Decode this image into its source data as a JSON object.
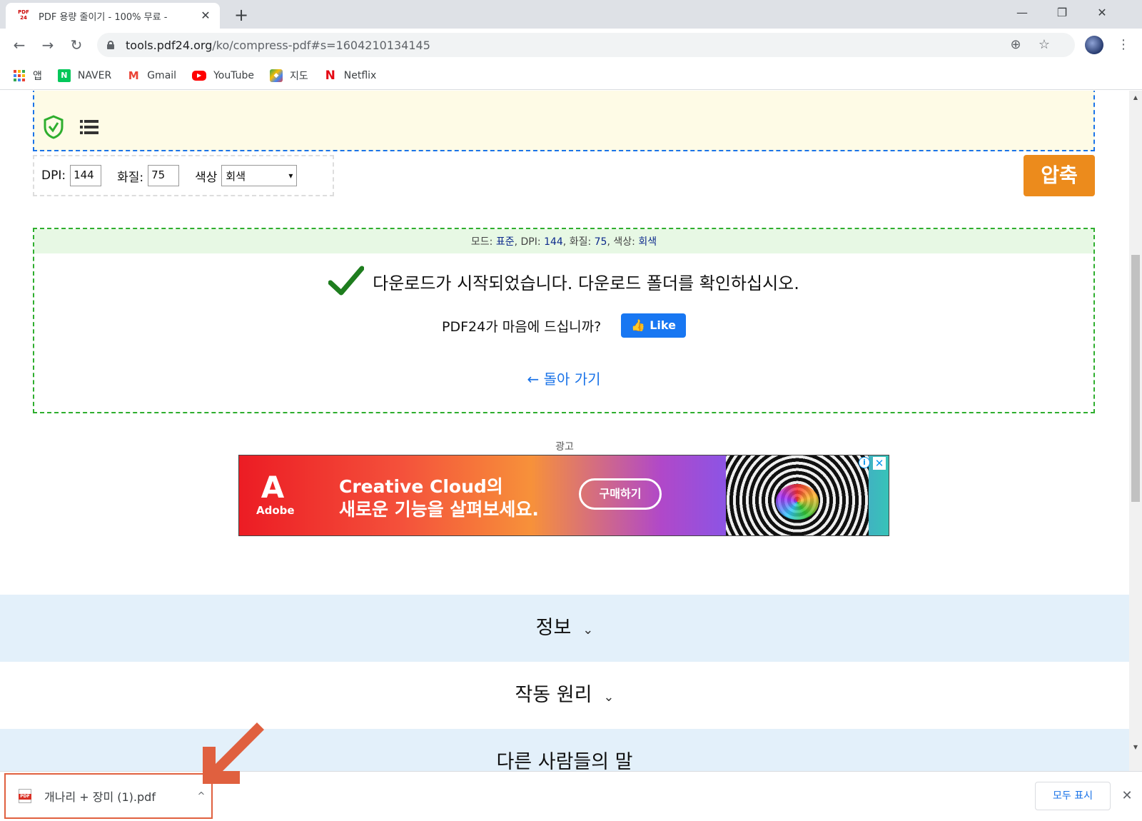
{
  "tab": {
    "favicon_top": "PDF",
    "favicon_bottom": "24",
    "title": "PDF 용량 줄이기 - 100% 무료 -",
    "close": "✕",
    "new_tab": "+"
  },
  "window": {
    "minimize": "—",
    "maximize": "❐",
    "close": "✕"
  },
  "nav": {
    "back": "←",
    "forward": "→",
    "reload": "↻"
  },
  "address": {
    "host": "tools.pdf24.org",
    "path": "/ko/compress-pdf#s=1604210134145"
  },
  "bookmarks": [
    {
      "label": "앱",
      "icon": "apps-grid-icon"
    },
    {
      "label": "NAVER",
      "icon": "naver-icon",
      "glyph": "N"
    },
    {
      "label": "Gmail",
      "icon": "gmail-icon",
      "glyph": "M"
    },
    {
      "label": "YouTube",
      "icon": "youtube-icon",
      "glyph": "▶"
    },
    {
      "label": "지도",
      "icon": "maps-icon",
      "glyph": "◆"
    },
    {
      "label": "Netflix",
      "icon": "netflix-icon",
      "glyph": "N"
    }
  ],
  "options": {
    "dpi_label": "DPI:",
    "dpi_value": "144",
    "quality_label": "화질:",
    "quality_value": "75",
    "color_label": "색상",
    "color_value": "회색"
  },
  "compress_button": "압축",
  "result": {
    "mode_label": "모드:",
    "mode_value": "표준",
    "dpi_label": "DPI:",
    "dpi_value": "144",
    "quality_label": "화질:",
    "quality_value": "75",
    "color_label": "색상:",
    "color_value": "회색",
    "message": "다운로드가 시작되었습니다. 다운로드 폴더를 확인하십시오.",
    "like_question": "PDF24가 마음에 드십니까?",
    "like_button": "Like",
    "back_link": "← 돌아 가기"
  },
  "ad": {
    "label": "광고",
    "brand": "Adobe",
    "line1": "Creative Cloud의",
    "line2": "새로운 기능을 살펴보세요.",
    "cta": "구매하기",
    "info": "i",
    "close": "✕"
  },
  "sections": [
    {
      "title": "정보"
    },
    {
      "title": "작동 원리"
    },
    {
      "title": "다른 사람들의 말"
    }
  ],
  "download_bar": {
    "filename": "개나리 + 장미 (1).pdf",
    "caret": "^",
    "show_all": "모두 표시",
    "close": "✕"
  },
  "colors": {
    "compress_button": "#ec8b1c",
    "result_border": "#2eae2e",
    "dropzone_border": "#1a73e8",
    "annotation_arrow": "#e0603f"
  }
}
